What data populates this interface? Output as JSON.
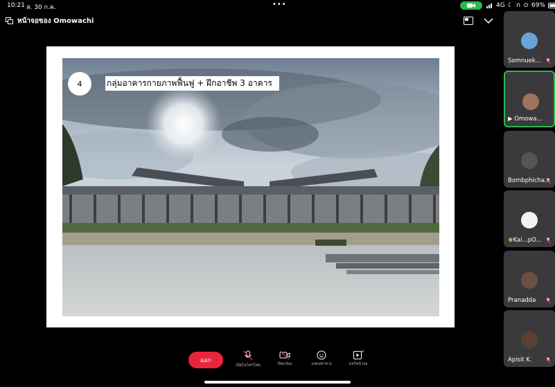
{
  "status": {
    "time": "10:21",
    "date": "ส. 30 ก.ค.",
    "network": "4G",
    "battery": "69%"
  },
  "header": {
    "share_title": "หน้าจอของ Omowachi"
  },
  "slide": {
    "number": "4",
    "caption": "กลุ่มอาคารกายภาพฟื้นฟู + ฝึกอาชีพ 3 อาคาร"
  },
  "participants": [
    {
      "name": "Somnuek...",
      "active": false,
      "video": false,
      "avatar_color": "#6aa3d8"
    },
    {
      "name": "Omowa...",
      "active": true,
      "video": true,
      "avatar_color": "#a0745a"
    },
    {
      "name": "Bombphicha...",
      "active": false,
      "video": false,
      "avatar_color": "#555"
    },
    {
      "name": "Kai...pO...",
      "active": false,
      "video": false,
      "avatar_color": "#f2f2f2"
    },
    {
      "name": "Pranadda",
      "active": false,
      "video": false,
      "avatar_color": "#6b5045"
    },
    {
      "name": "Apisit K.",
      "active": false,
      "video": false,
      "avatar_color": "#5a4030"
    }
  ],
  "controls": {
    "leave": "ออก",
    "mic": "เปิดไมโครโฟน",
    "camera": "เปิดกล้อง",
    "reactions": "แสดงท่าทาง",
    "share": "แชร์หน้าจอ"
  },
  "colors": {
    "accent": "#2eb84b",
    "leave": "#e8253a",
    "tile": "#3a3a3c"
  }
}
